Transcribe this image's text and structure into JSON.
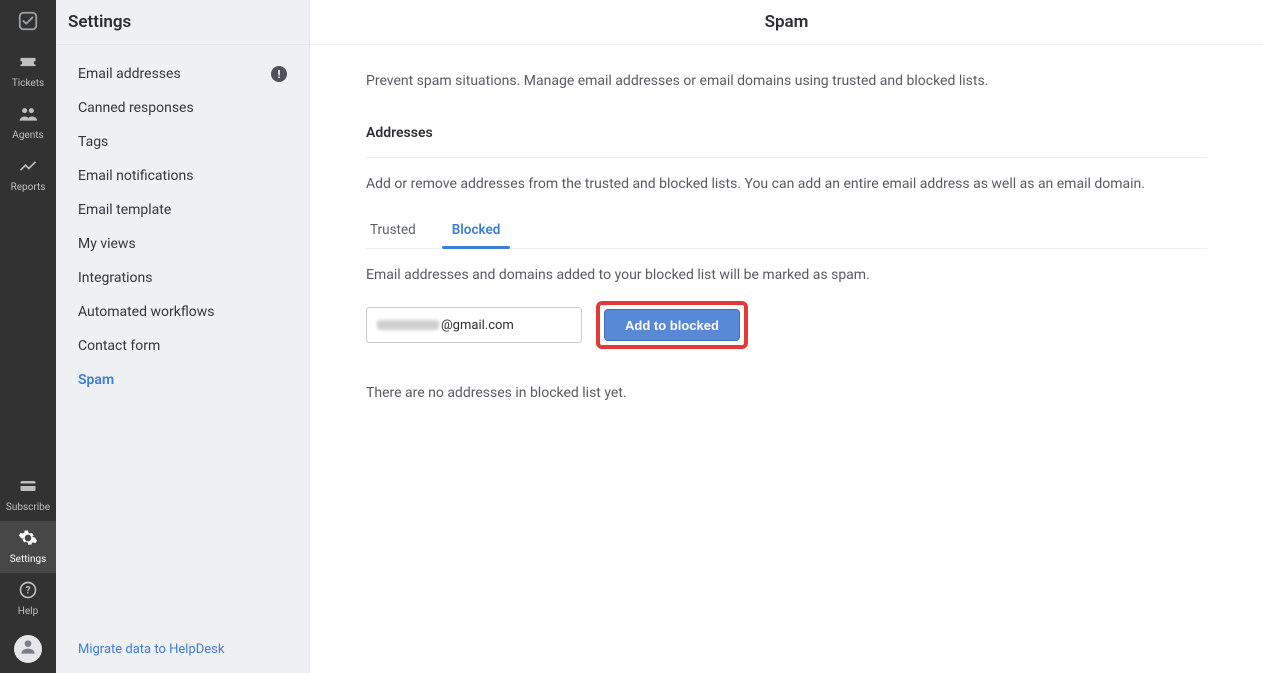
{
  "colors": {
    "accent": "#3c7dd9",
    "highlight_border": "#e53935"
  },
  "rail": {
    "logo": "check-square-icon",
    "items_top": [
      {
        "icon": "ticket-icon",
        "label": "Tickets"
      },
      {
        "icon": "people-icon",
        "label": "Agents"
      },
      {
        "icon": "chart-icon",
        "label": "Reports"
      }
    ],
    "items_bottom": [
      {
        "icon": "card-icon",
        "label": "Subscribe",
        "active": false
      },
      {
        "icon": "gear-icon",
        "label": "Settings",
        "active": true
      },
      {
        "icon": "help-icon",
        "label": "Help",
        "active": false
      }
    ]
  },
  "sidebar": {
    "title": "Settings",
    "items": [
      {
        "label": "Email addresses",
        "notice": "!",
        "selected": false
      },
      {
        "label": "Canned responses",
        "selected": false
      },
      {
        "label": "Tags",
        "selected": false
      },
      {
        "label": "Email notifications",
        "selected": false
      },
      {
        "label": "Email template",
        "selected": false
      },
      {
        "label": "My views",
        "selected": false
      },
      {
        "label": "Integrations",
        "selected": false
      },
      {
        "label": "Automated workflows",
        "selected": false
      },
      {
        "label": "Contact form",
        "selected": false
      },
      {
        "label": "Spam",
        "selected": true
      }
    ],
    "footer_link": "Migrate data to HelpDesk"
  },
  "main": {
    "title": "Spam",
    "intro": "Prevent spam situations. Manage email addresses or email domains using trusted and blocked lists.",
    "section_title": "Addresses",
    "section_desc": "Add or remove addresses from the trusted and blocked lists. You can add an entire email address as well as an email domain.",
    "tabs": [
      {
        "label": "Trusted",
        "active": false
      },
      {
        "label": "Blocked",
        "active": true
      }
    ],
    "tab_desc": "Email addresses and domains added to your blocked list will be marked as spam.",
    "input_value_visible_suffix": "@gmail.com",
    "add_button": "Add to blocked",
    "empty_message": "There are no addresses in blocked list yet."
  }
}
